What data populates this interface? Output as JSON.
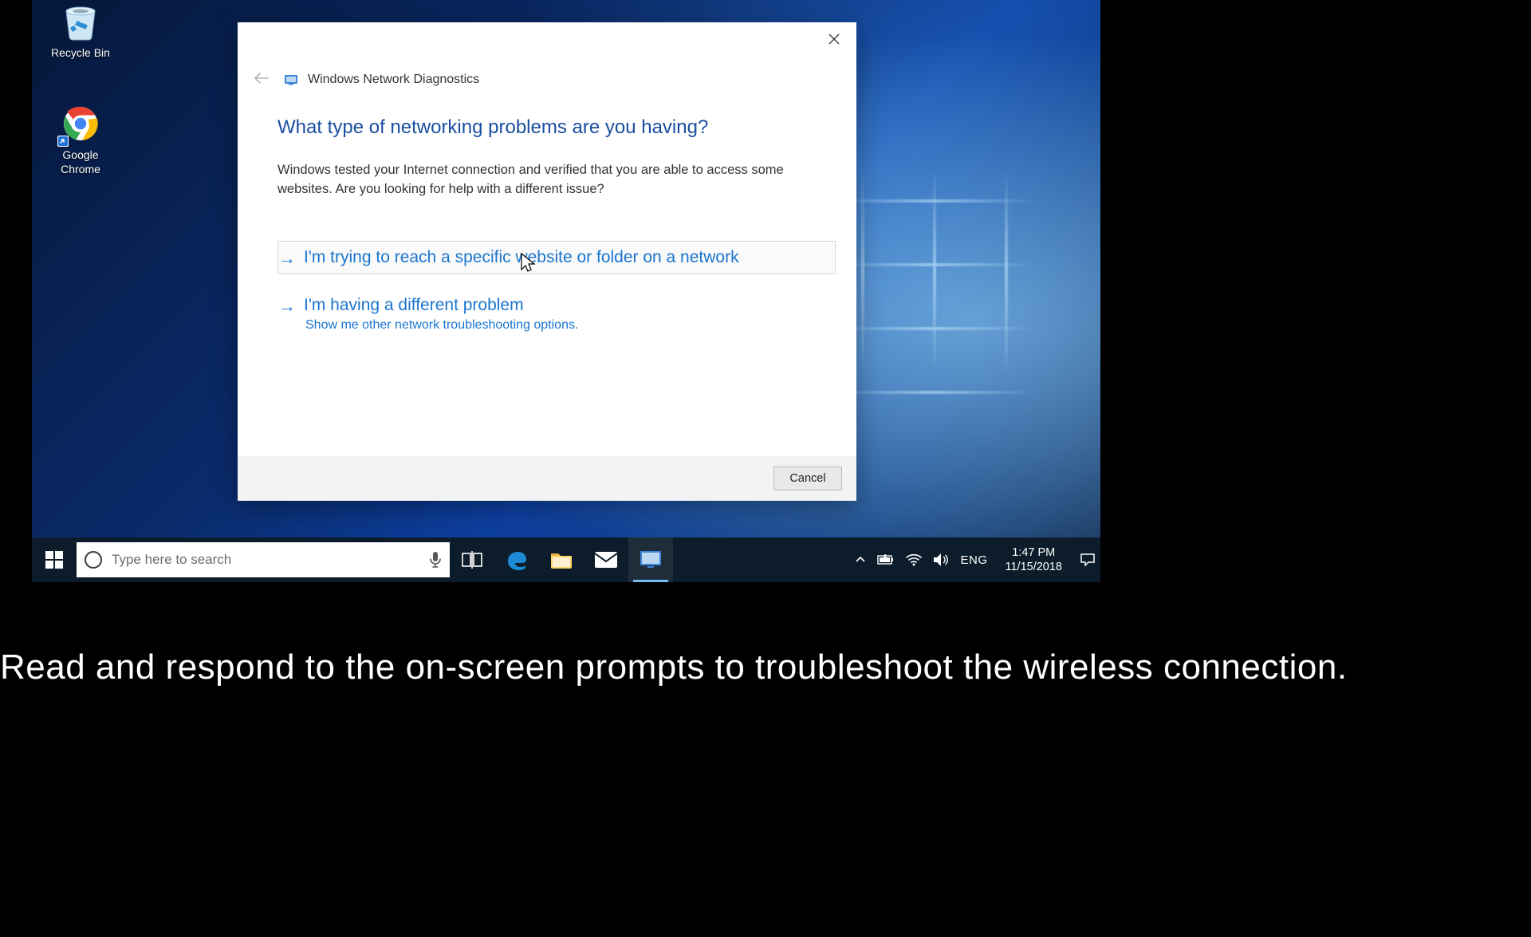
{
  "desktop": {
    "icons": [
      {
        "label": "Recycle Bin",
        "name": "recycle-bin"
      },
      {
        "label": "Google Chrome",
        "name": "google-chrome"
      }
    ]
  },
  "dialog": {
    "title": "Windows Network Diagnostics",
    "heading": "What type of networking problems are you having?",
    "lead": "Windows tested your Internet connection and verified that you are able to access some websites. Are you looking for help with a different issue?",
    "options": [
      {
        "title": "I'm trying to reach a specific website or folder on a network",
        "subtitle": ""
      },
      {
        "title": "I'm having a different problem",
        "subtitle": "Show me other network troubleshooting options."
      }
    ],
    "cancel": "Cancel",
    "close_tooltip": "Close"
  },
  "taskbar": {
    "search_placeholder": "Type here to search",
    "lang": "ENG",
    "time": "1:47 PM",
    "date": "11/15/2018"
  },
  "caption": "Read and respond to the on-screen prompts to troubleshoot the wireless connection."
}
